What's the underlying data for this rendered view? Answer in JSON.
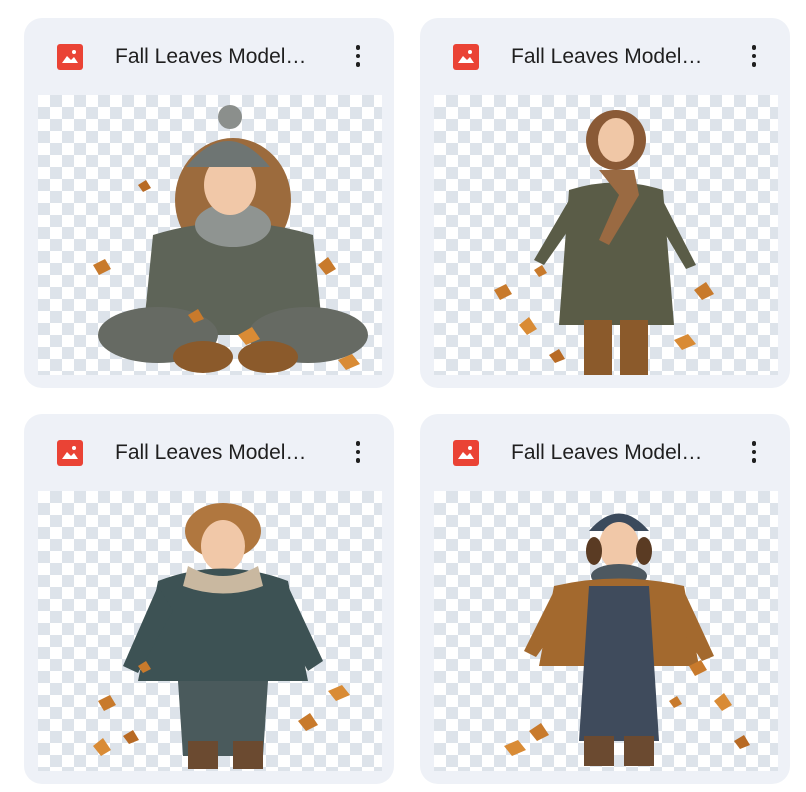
{
  "files": [
    {
      "title": "Fall Leaves Model…",
      "icon": "image-file-icon",
      "accent": "#ea4335"
    },
    {
      "title": "Fall Leaves Model…",
      "icon": "image-file-icon",
      "accent": "#ea4335"
    },
    {
      "title": "Fall Leaves Model…",
      "icon": "image-file-icon",
      "accent": "#ea4335"
    },
    {
      "title": "Fall Leaves Model…",
      "icon": "image-file-icon",
      "accent": "#ea4335"
    }
  ]
}
